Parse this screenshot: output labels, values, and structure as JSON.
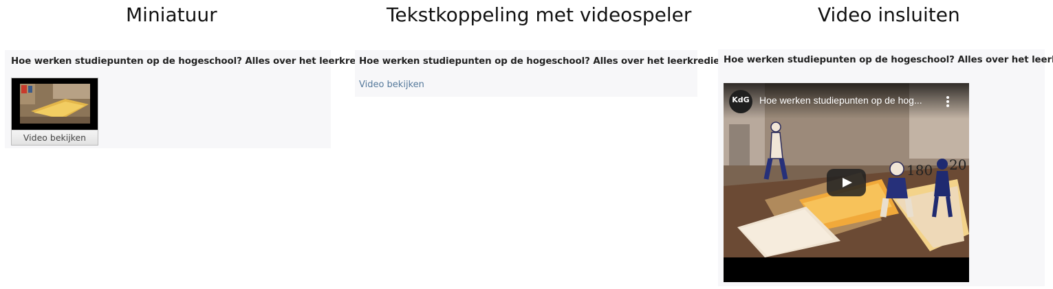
{
  "columns": {
    "thumbnail": {
      "heading": "Miniatuur"
    },
    "text_link": {
      "heading": "Tekstkoppeling met videospeler"
    },
    "embed": {
      "heading": "Video insluiten"
    }
  },
  "panels": {
    "thumbnail": {
      "title": "Hoe werken studiepunten op de hogeschool? Alles over het leerkrediet!",
      "button_label": "Video bekijken"
    },
    "text_link": {
      "title": "Hoe werken studiepunten op de hogeschool? Alles over het leerkrediet!",
      "link_label": "Video bekijken"
    },
    "embed": {
      "title": "Hoe werken studiepunten op de hogeschool? Alles over het leerkrediet!",
      "video_title": "Hoe werken studiepunten op de hog...",
      "channel_logo": "KdG",
      "video_numbers": [
        "180",
        "20"
      ],
      "icons": [
        "play-icon",
        "more-vert-icon"
      ]
    }
  },
  "colors": {
    "panel_background": "#f7f7f9",
    "link": "#55799b",
    "player_background": "#000000"
  }
}
